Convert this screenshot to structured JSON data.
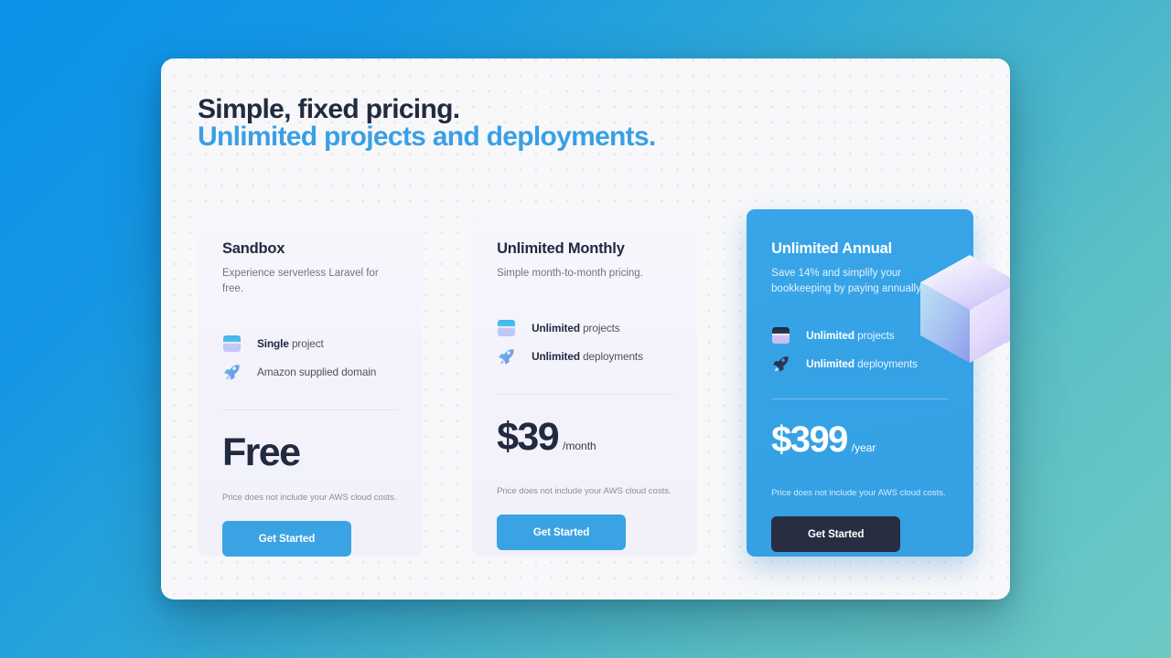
{
  "heading": {
    "line1": "Simple, fixed pricing.",
    "line2": "Unlimited projects and deployments."
  },
  "colors": {
    "accent_blue": "#3aa3e3",
    "heading_dark": "#222a3f",
    "heading_blue": "#3aa0e4",
    "feature_card_bg": "#35a2e6",
    "feature_cta_bg": "#272e42",
    "background_from": "#0b93e8",
    "background_to": "#6ec9c4"
  },
  "plans": [
    {
      "name": "Sandbox",
      "description": "Experience serverless Laravel for free.",
      "features": [
        {
          "icon": "box-icon",
          "strong": "Single",
          "rest": " project"
        },
        {
          "icon": "rocket-icon",
          "strong": "",
          "rest": "Amazon supplied domain"
        }
      ],
      "price": "Free",
      "period": "",
      "note": "Price does not include your AWS cloud costs.",
      "cta": "Get Started"
    },
    {
      "name": "Unlimited Monthly",
      "description": "Simple month-to-month pricing.",
      "features": [
        {
          "icon": "box-icon",
          "strong": "Unlimited",
          "rest": " projects"
        },
        {
          "icon": "rocket-icon",
          "strong": "Unlimited",
          "rest": " deployments"
        }
      ],
      "price": "$39",
      "period": "/month",
      "note": "Price does not include your AWS cloud costs.",
      "cta": "Get Started"
    },
    {
      "name": "Unlimited Annual",
      "description": "Save 14% and simplify your bookkeeping by paying annually.",
      "features": [
        {
          "icon": "box-icon",
          "strong": "Unlimited",
          "rest": " projects"
        },
        {
          "icon": "rocket-icon",
          "strong": "Unlimited",
          "rest": " deployments"
        }
      ],
      "price": "$399",
      "period": "/year",
      "note": "Price does not include your AWS cloud costs.",
      "cta": "Get Started"
    }
  ]
}
